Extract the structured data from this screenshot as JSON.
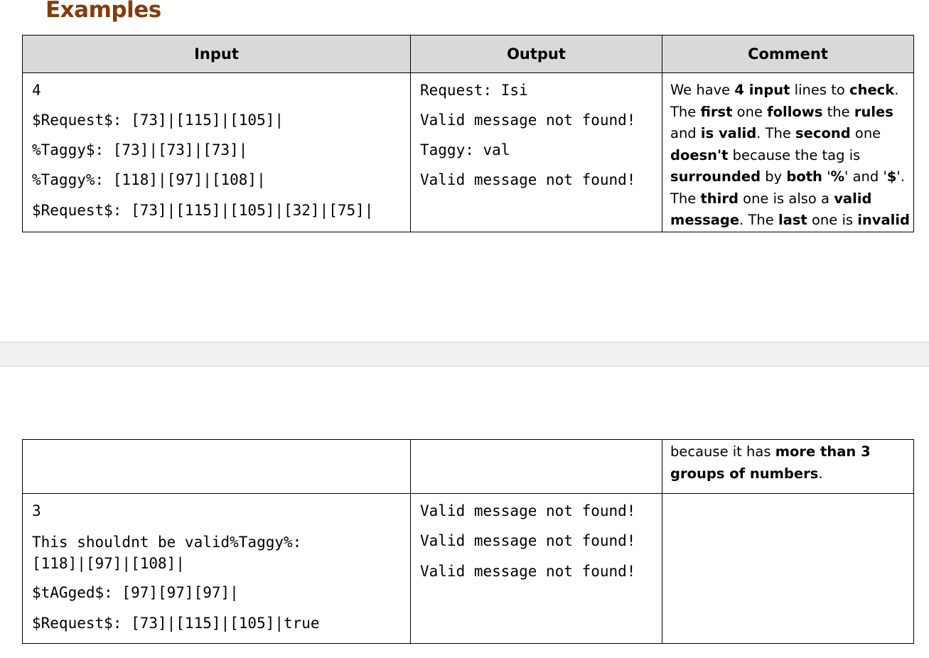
{
  "heading": "Examples",
  "headers": {
    "input": "Input",
    "output": "Output",
    "comment": "Comment"
  },
  "example1": {
    "input_lines": [
      "4",
      "$Request$: [73]|[115]|[105]|",
      "%Taggy$: [73]|[73]|[73]|",
      "%Taggy%: [118]|[97]|[108]|",
      "$Request$: [73]|[115]|[105]|[32]|[75]|"
    ],
    "output_lines": [
      "Request: Isi",
      "Valid message not found!",
      "Taggy: val",
      "Valid message not found!"
    ],
    "comment_page1": [
      [
        {
          "t": "We have ",
          "b": false
        },
        {
          "t": "4 input",
          "b": true
        },
        {
          "t": " lines to ",
          "b": false
        },
        {
          "t": "check",
          "b": true
        },
        {
          "t": ".",
          "b": false
        }
      ],
      [
        {
          "t": "The ",
          "b": false
        },
        {
          "t": "first",
          "b": true
        },
        {
          "t": " one ",
          "b": false
        },
        {
          "t": "follows",
          "b": true
        },
        {
          "t": " the ",
          "b": false
        },
        {
          "t": "rules",
          "b": true
        }
      ],
      [
        {
          "t": "and ",
          "b": false
        },
        {
          "t": "is valid",
          "b": true
        },
        {
          "t": ". The ",
          "b": false
        },
        {
          "t": "second",
          "b": true
        },
        {
          "t": " one",
          "b": false
        }
      ],
      [
        {
          "t": "doesn't",
          "b": true
        },
        {
          "t": " because the tag is",
          "b": false
        }
      ],
      [
        {
          "t": "surrounded",
          "b": true
        },
        {
          "t": " by ",
          "b": false
        },
        {
          "t": "both",
          "b": true
        },
        {
          "t": " '",
          "b": false
        },
        {
          "t": "%",
          "b": true
        },
        {
          "t": "' and '",
          "b": false
        },
        {
          "t": "$",
          "b": true
        },
        {
          "t": "'.",
          "b": false
        }
      ],
      [
        {
          "t": "The ",
          "b": false
        },
        {
          "t": "third",
          "b": true
        },
        {
          "t": " one is also a ",
          "b": false
        },
        {
          "t": "valid",
          "b": true
        }
      ],
      [
        {
          "t": "message",
          "b": true
        },
        {
          "t": ". The ",
          "b": false
        },
        {
          "t": "last",
          "b": true
        },
        {
          "t": " one is ",
          "b": false
        },
        {
          "t": "invalid",
          "b": true
        }
      ]
    ],
    "comment_page2": [
      [
        {
          "t": "because it has ",
          "b": false
        },
        {
          "t": "more than 3",
          "b": true
        }
      ],
      [
        {
          "t": "groups of numbers",
          "b": true
        },
        {
          "t": ".",
          "b": false
        }
      ]
    ]
  },
  "example2": {
    "input_lines": [
      "3",
      "This shouldnt be valid%Taggy%:\n[118]|[97]|[108]|",
      "$tAGged$: [97][97][97]|",
      "$Request$: [73]|[115]|[105]|true"
    ],
    "output_lines": [
      "Valid message not found!",
      "Valid message not found!",
      "Valid message not found!"
    ],
    "comment": ""
  }
}
